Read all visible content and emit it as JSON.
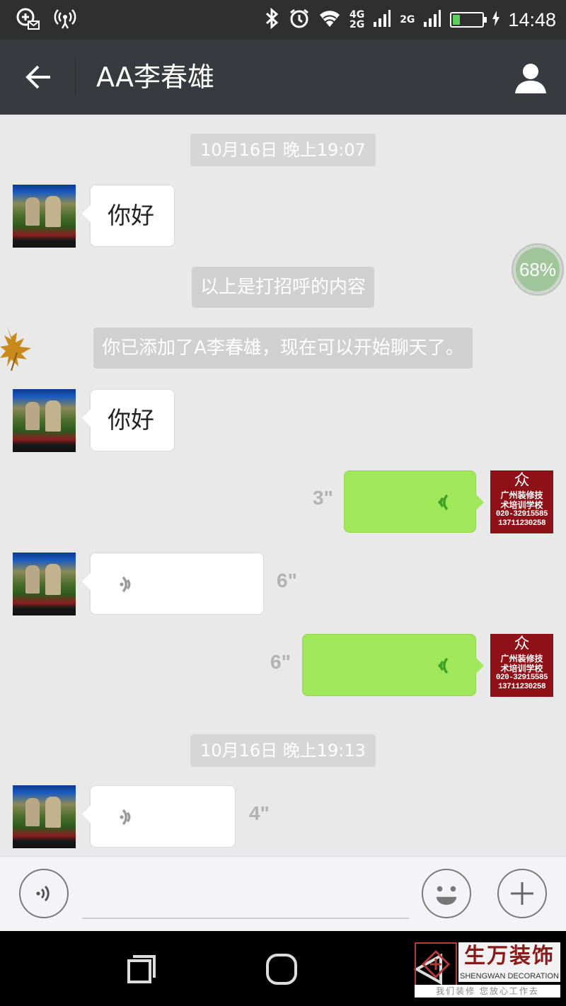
{
  "status_bar": {
    "network_labels": [
      "4G",
      "2G",
      "2G"
    ],
    "battery_level": 0.25,
    "time": "14:48"
  },
  "header": {
    "title": "AA李春雄"
  },
  "chat": {
    "timestamps": [
      "10月16日 晚上19:07",
      "10月16日 晚上19:13"
    ],
    "system_messages": [
      "以上是打招呼的内容",
      "你已添加了A李春雄，现在可以开始聊天了。"
    ],
    "messages": [
      {
        "side": "left",
        "type": "text",
        "text": "你好"
      },
      {
        "side": "left",
        "type": "text",
        "text": "你好"
      },
      {
        "side": "right",
        "type": "voice",
        "duration": "3\""
      },
      {
        "side": "left",
        "type": "voice",
        "duration": "6\""
      },
      {
        "side": "right",
        "type": "voice",
        "duration": "6\""
      },
      {
        "side": "left",
        "type": "voice",
        "duration": "4\""
      }
    ],
    "avatar_right": {
      "logo": "众",
      "line1": "广州装修技",
      "line2": "术培训学校",
      "phone1": "020-32915585",
      "phone2": "13711230258"
    },
    "progress_badge": "68%"
  },
  "input_bar": {
    "voice_icon": "voice-icon",
    "emoji_icon": "smiley-icon",
    "add_icon": "plus-icon"
  },
  "watermark": {
    "title": "生万装饰",
    "subtitle": "SHENGWAN DECORATION",
    "slogan": "我们装修 您放心工作去"
  },
  "colors": {
    "header_bg": "#393a3f",
    "self_bubble": "#a0e75a",
    "chat_bg": "#e9e9e9"
  }
}
